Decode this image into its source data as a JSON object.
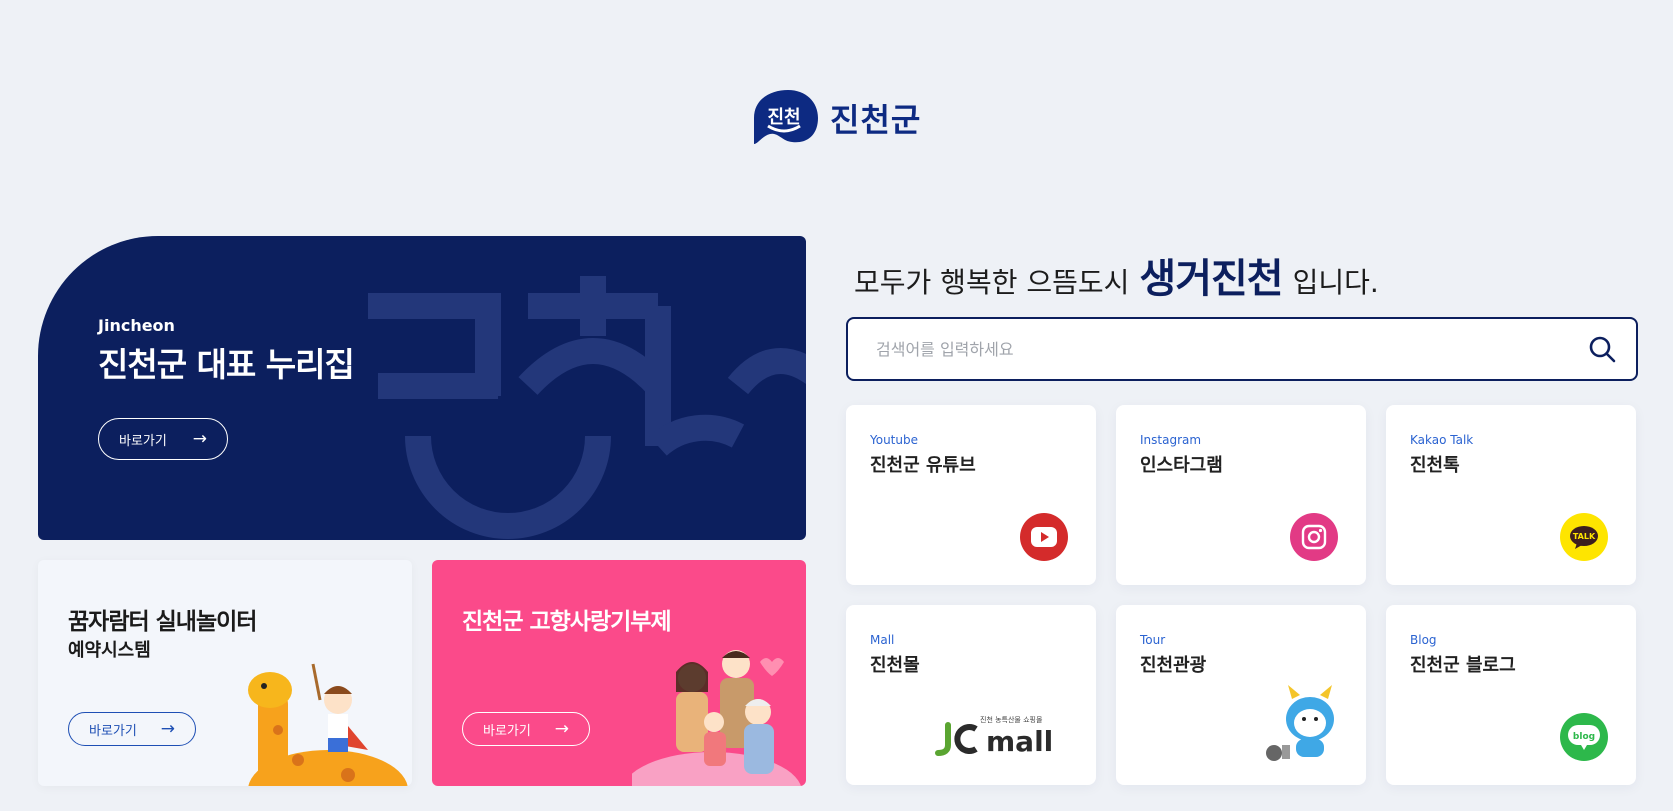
{
  "logo": {
    "text": "진천군"
  },
  "hero": {
    "eyebrow": "Jincheon",
    "title": "진천군 대표 누리집",
    "button_label": "바로가기"
  },
  "cards": {
    "kids": {
      "title_line1": "꿈자람터 실내놀이터",
      "title_line2": "예약시스템",
      "button_label": "바로가기"
    },
    "love": {
      "title": "진천군 고향사랑기부제",
      "button_label": "바로가기"
    }
  },
  "tagline": {
    "before": "모두가 행복한 으뜸도시",
    "brand": "생거진천",
    "after": "입니다."
  },
  "search": {
    "placeholder": "검색어를 입력하세요",
    "value": ""
  },
  "tiles": [
    {
      "en": "Youtube",
      "ko": "진천군 유튜브",
      "icon": "youtube-icon",
      "color": "#d42b2b"
    },
    {
      "en": "Instagram",
      "ko": "인스타그램",
      "icon": "instagram-icon",
      "color": "#e23a85"
    },
    {
      "en": "Kakao Talk",
      "ko": "진천톡",
      "icon": "kakao-talk-icon",
      "color": "#fee500"
    },
    {
      "en": "Mall",
      "ko": "진천몰",
      "icon": "jc-mall-logo",
      "logo_small": "진천 농특산물 쇼핑몰",
      "logo_main": "mall"
    },
    {
      "en": "Tour",
      "ko": "진천관광",
      "icon": "tour-mascot-icon"
    },
    {
      "en": "Blog",
      "ko": "진천군 블로그",
      "icon": "blog-icon",
      "color": "#2db84b",
      "icon_text": "blog"
    }
  ],
  "kakao_icon_text": "TALK",
  "colors": {
    "navy": "#0c1f5e",
    "pink": "#fb4a8a",
    "accent_blue": "#2b63d1"
  }
}
